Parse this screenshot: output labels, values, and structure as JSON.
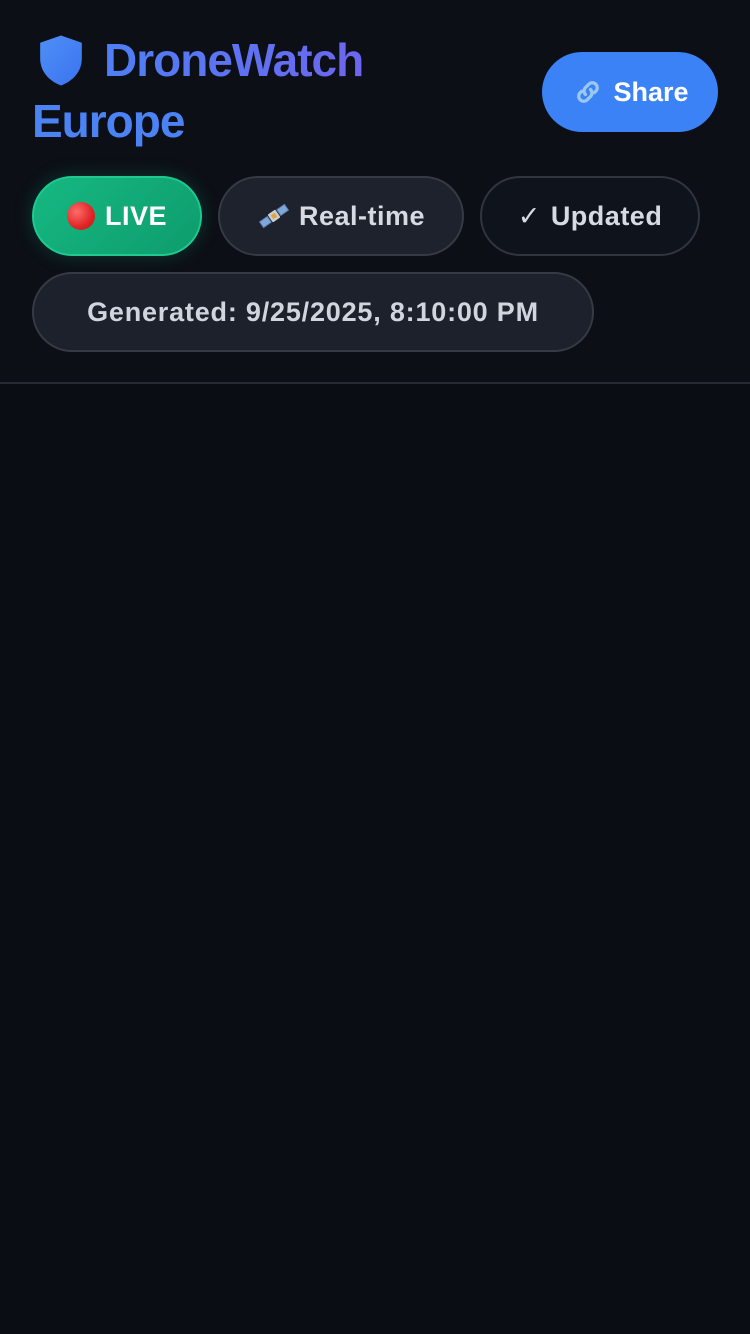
{
  "header": {
    "title_line1": "DroneWatch",
    "title_line2": "Europe",
    "share_label": "Share",
    "share_icon": "link-icon",
    "title_icon": "shield-icon"
  },
  "status": {
    "live_label": "LIVE",
    "live_icon": "red-circle-icon",
    "realtime_label": "Real-time",
    "realtime_icon": "satellite-icon",
    "updated_label": "Updated",
    "updated_icon": "check-icon",
    "generated_label": "Generated: 9/25/2025, 8:10:00 PM"
  },
  "colors": {
    "accent": "#3b82f6",
    "live": "#10b981",
    "background": "#0a0d14"
  }
}
